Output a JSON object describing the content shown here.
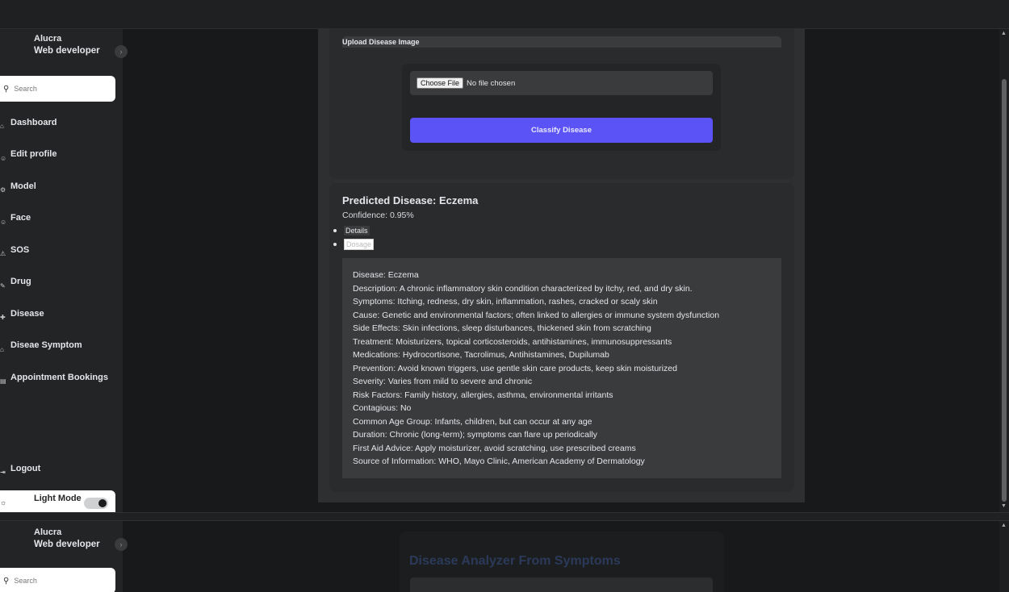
{
  "profile": {
    "name": "Alucra",
    "role": "Web developer"
  },
  "search": {
    "placeholder": "Search"
  },
  "nav": [
    {
      "label": "Dashboard",
      "icon": "home-icon"
    },
    {
      "label": "Edit profile",
      "icon": "user-icon"
    },
    {
      "label": "Model",
      "icon": "model-icon"
    },
    {
      "label": "Face",
      "icon": "face-icon"
    },
    {
      "label": "SOS",
      "icon": "sos-icon"
    },
    {
      "label": "Drug",
      "icon": "drug-icon"
    },
    {
      "label": "Disease",
      "icon": "disease-icon"
    },
    {
      "label": "Diseae Symptom",
      "icon": "symptom-icon"
    },
    {
      "label": "Appointment Bookings",
      "icon": "calendar-icon"
    }
  ],
  "logout": {
    "label": "Logout"
  },
  "mode": {
    "label": "Light Mode"
  },
  "upload": {
    "header": "Upload Disease Image",
    "file_button": "Choose File",
    "file_status": "No file chosen",
    "classify_button": "Classify Disease"
  },
  "result": {
    "title": "Predicted Disease: Eczema",
    "confidence": "Confidence: 0.95%",
    "tabs": {
      "details": "Details",
      "dosage": "Dosage"
    },
    "lines": [
      "Disease: Eczema",
      "Description: A chronic inflammatory skin condition characterized by itchy, red, and dry skin.",
      "Symptoms: Itching, redness, dry skin, inflammation, rashes, cracked or scaly skin",
      "Cause: Genetic and environmental factors; often linked to allergies or immune system dysfunction",
      "Side Effects: Skin infections, sleep disturbances, thickened skin from scratching",
      "Treatment: Moisturizers, topical corticosteroids, antihistamines, immunosuppressants",
      "Medications: Hydrocortisone, Tacrolimus, Antihistamines, Dupilumab",
      "Prevention: Avoid known triggers, use gentle skin care products, keep skin moisturized",
      "Severity: Varies from mild to severe and chronic",
      "Risk Factors: Family history, allergies, asthma, environmental irritants",
      "Contagious: No",
      "Common Age Group: Infants, children, but can occur at any age",
      "Duration: Chronic (long-term); symptoms can flare up periodically",
      "First Aid Advice: Apply moisturizer, avoid scratching, use prescribed creams",
      "Source of Information: WHO, Mayo Clinic, American Academy of Dermatology"
    ]
  },
  "lower": {
    "title": "Disease Analyzer From Symptoms"
  }
}
